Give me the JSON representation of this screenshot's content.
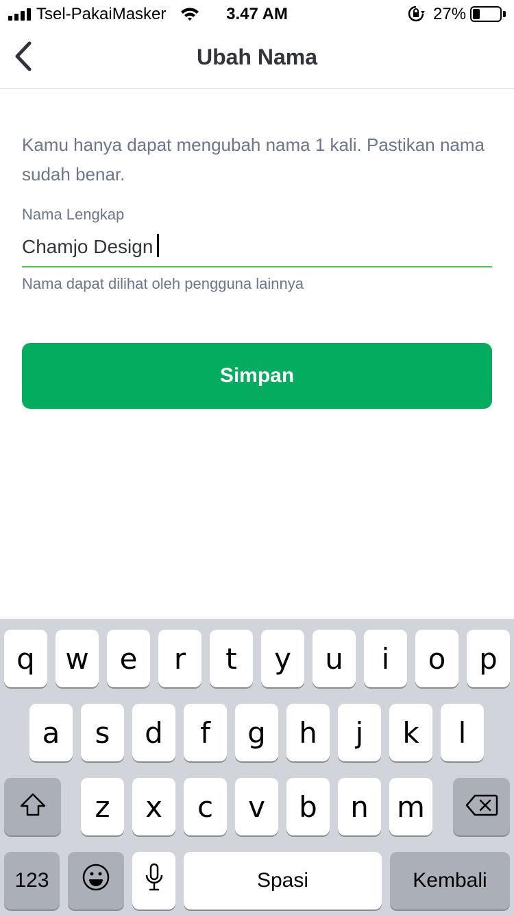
{
  "status_bar": {
    "carrier": "Tsel-PakaiMasker",
    "time": "3.47 AM",
    "battery_percent": "27%",
    "battery_level": 0.27,
    "signal_bars": 4,
    "icons": [
      "signal-icon",
      "wifi-icon",
      "rotation-lock-icon",
      "battery-icon"
    ]
  },
  "nav": {
    "title": "Ubah Nama",
    "back_icon": "chevron-left-icon"
  },
  "form": {
    "info": "Kamu hanya dapat mengubah nama 1 kali. Pastikan nama sudah benar.",
    "label": "Nama Lengkap",
    "value": "Chamjo Design",
    "helper": "Nama dapat dilihat oleh pengguna lainnya",
    "save_label": "Simpan"
  },
  "colors": {
    "primary_green": "#03ac5f",
    "input_underline": "#5ac35f",
    "title_text": "#31353b",
    "secondary_text": "#6d7588",
    "keyboard_bg": "#d1d4da"
  },
  "keyboard": {
    "row1": [
      "q",
      "w",
      "e",
      "r",
      "t",
      "y",
      "u",
      "i",
      "o",
      "p"
    ],
    "row2": [
      "a",
      "s",
      "d",
      "f",
      "g",
      "h",
      "j",
      "k",
      "l"
    ],
    "row3": [
      "z",
      "x",
      "c",
      "v",
      "b",
      "n",
      "m"
    ],
    "numbers_label": "123",
    "space_label": "Spasi",
    "return_label": "Kembali",
    "shift_icon": "shift-icon",
    "delete_icon": "backspace-icon",
    "emoji_icon": "emoji-icon",
    "mic_icon": "microphone-icon"
  }
}
